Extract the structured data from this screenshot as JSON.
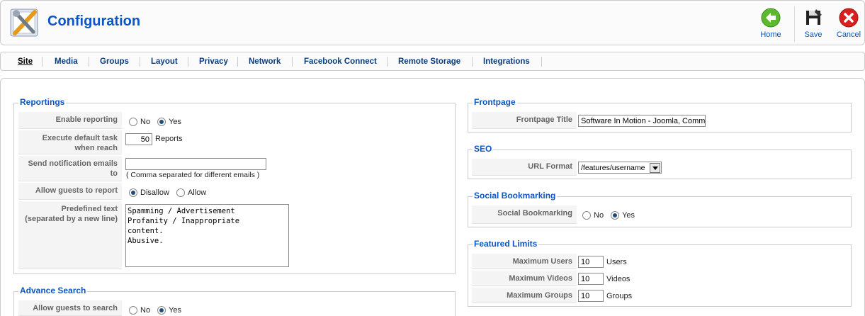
{
  "header": {
    "title": "Configuration",
    "buttons": {
      "home": "Home",
      "save": "Save",
      "cancel": "Cancel"
    }
  },
  "tabs": [
    "Site",
    "Media",
    "Groups",
    "Layout",
    "Privacy",
    "Network",
    "Facebook Connect",
    "Remote Storage",
    "Integrations"
  ],
  "active_tab": "Site",
  "reportings": {
    "legend": "Reportings",
    "enable_reporting": {
      "label": "Enable reporting",
      "options": [
        "No",
        "Yes"
      ],
      "selected": "Yes"
    },
    "execute_default_task": {
      "label_line1": "Execute default task",
      "label_line2": "when reach",
      "value": "50",
      "suffix": "Reports"
    },
    "send_notification": {
      "label_line1": "Send notification emails",
      "label_line2": "to",
      "value": "",
      "hint": "( Comma separated for different emails )"
    },
    "allow_guests": {
      "label": "Allow guests to report",
      "options": [
        "Disallow",
        "Allow"
      ],
      "selected": "Disallow"
    },
    "predefined_text": {
      "label_line1": "Predefined text",
      "label_line2": "(separated by a new line)",
      "lines": [
        "Spamming / Advertisement",
        "Profanity / Inappropriate",
        "content.",
        "Abusive."
      ]
    }
  },
  "advance_search": {
    "legend": "Advance Search",
    "allow_guests_search": {
      "label": "Allow guests to search",
      "options": [
        "No",
        "Yes"
      ],
      "selected": "Yes"
    }
  },
  "frontpage": {
    "legend": "Frontpage",
    "title_label": "Frontpage Title",
    "title_value": "Software In Motion - Joomla, Commur"
  },
  "seo": {
    "legend": "SEO",
    "url_format_label": "URL Format",
    "url_format_value": "/features/username"
  },
  "social_bookmarking": {
    "legend": "Social Bookmarking",
    "label": "Social Bookmarking",
    "options": [
      "No",
      "Yes"
    ],
    "selected": "Yes"
  },
  "featured_limits": {
    "legend": "Featured Limits",
    "rows": [
      {
        "label": "Maximum Users",
        "value": "10",
        "suffix": "Users"
      },
      {
        "label": "Maximum Videos",
        "value": "10",
        "suffix": "Videos"
      },
      {
        "label": "Maximum Groups",
        "value": "10",
        "suffix": "Groups"
      }
    ]
  },
  "colors": {
    "accent": "#0b55c4",
    "tab_text": "#0b3c7c",
    "home_icon": "#5cb82e",
    "cancel_icon": "#d72020"
  }
}
